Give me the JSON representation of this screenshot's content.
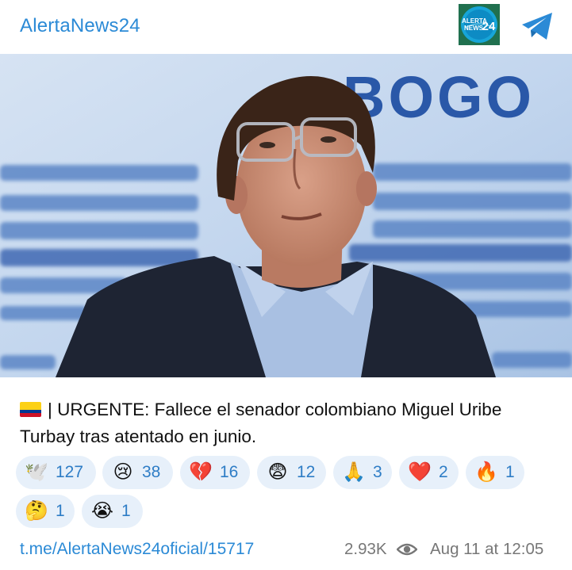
{
  "channel": {
    "name": "AlertaNews24",
    "avatar_text_top": "ALERTA",
    "avatar_text_bottom": "NEWS",
    "avatar_number": "24"
  },
  "photo": {
    "background_text": "BOGO"
  },
  "message": {
    "flag_icon": "colombia-flag",
    "text": "| URGENTE: Fallece el senador colombiano Miguel Uribe Turbay tras atentado en junio."
  },
  "reactions": [
    {
      "emoji": "🕊️",
      "count": "127",
      "name": "dove"
    },
    {
      "emoji": "😢",
      "count": "38",
      "name": "crying-face"
    },
    {
      "emoji": "💔",
      "count": "16",
      "name": "broken-heart"
    },
    {
      "emoji": "😨",
      "count": "12",
      "name": "fearful-face"
    },
    {
      "emoji": "🙏",
      "count": "3",
      "name": "folded-hands"
    },
    {
      "emoji": "❤️",
      "count": "2",
      "name": "red-heart"
    },
    {
      "emoji": "🔥",
      "count": "1",
      "name": "fire"
    },
    {
      "emoji": "🤔",
      "count": "1",
      "name": "thinking-face"
    },
    {
      "emoji": "😭",
      "count": "1",
      "name": "loudly-crying-face"
    }
  ],
  "footer": {
    "link": "t.me/AlertaNews24oficial/15717",
    "views": "2.93K",
    "timestamp": "Aug 11 at 12:05"
  },
  "colors": {
    "accent": "#2b8ad6",
    "reaction_bg": "#e7f0fa",
    "reaction_text": "#2e7dc6",
    "muted": "#777777"
  }
}
